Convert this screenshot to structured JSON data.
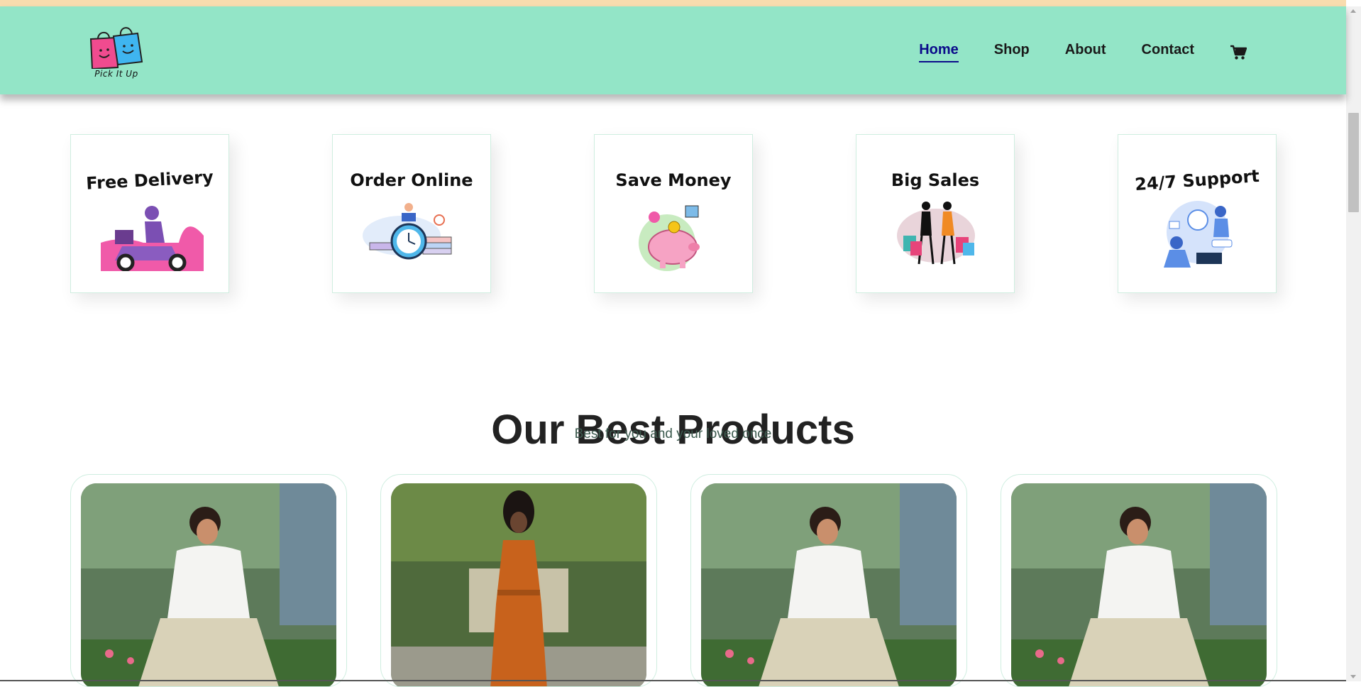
{
  "brand": {
    "logo_text": "Pick It Up"
  },
  "nav": {
    "items": [
      {
        "label": "Home",
        "active": true
      },
      {
        "label": "Shop",
        "active": false
      },
      {
        "label": "About",
        "active": false
      },
      {
        "label": "Contact",
        "active": false
      }
    ],
    "cart_icon": "shopping-cart-icon"
  },
  "features": [
    {
      "title": "Free Delivery",
      "icon": "scooter-delivery-icon",
      "accent": "#f05aa9"
    },
    {
      "title": "Order Online",
      "icon": "clock-order-icon",
      "accent": "#4fb7ea"
    },
    {
      "title": "Save Money",
      "icon": "piggy-bank-icon",
      "accent": "#f6a3c4"
    },
    {
      "title": "Big Sales",
      "icon": "shopping-women-icon",
      "accent": "#e7447a"
    },
    {
      "title": "24/7 Support",
      "icon": "customer-support-icon",
      "accent": "#5b8ee6"
    }
  ],
  "products_section": {
    "title": "Our Best Products",
    "subtitle": "Best for you and your loved once"
  },
  "products": [
    {
      "image": "woman-white-shirt-skirt-photo"
    },
    {
      "image": "woman-orange-dress-photo"
    },
    {
      "image": "woman-white-shirt-skirt-photo"
    },
    {
      "image": "woman-white-shirt-skirt-photo"
    }
  ],
  "colors": {
    "header_bg": "#93e5c7",
    "top_strip": "#f8dcae",
    "nav_active": "#0b0b8a",
    "card_border": "#cfeee0"
  }
}
